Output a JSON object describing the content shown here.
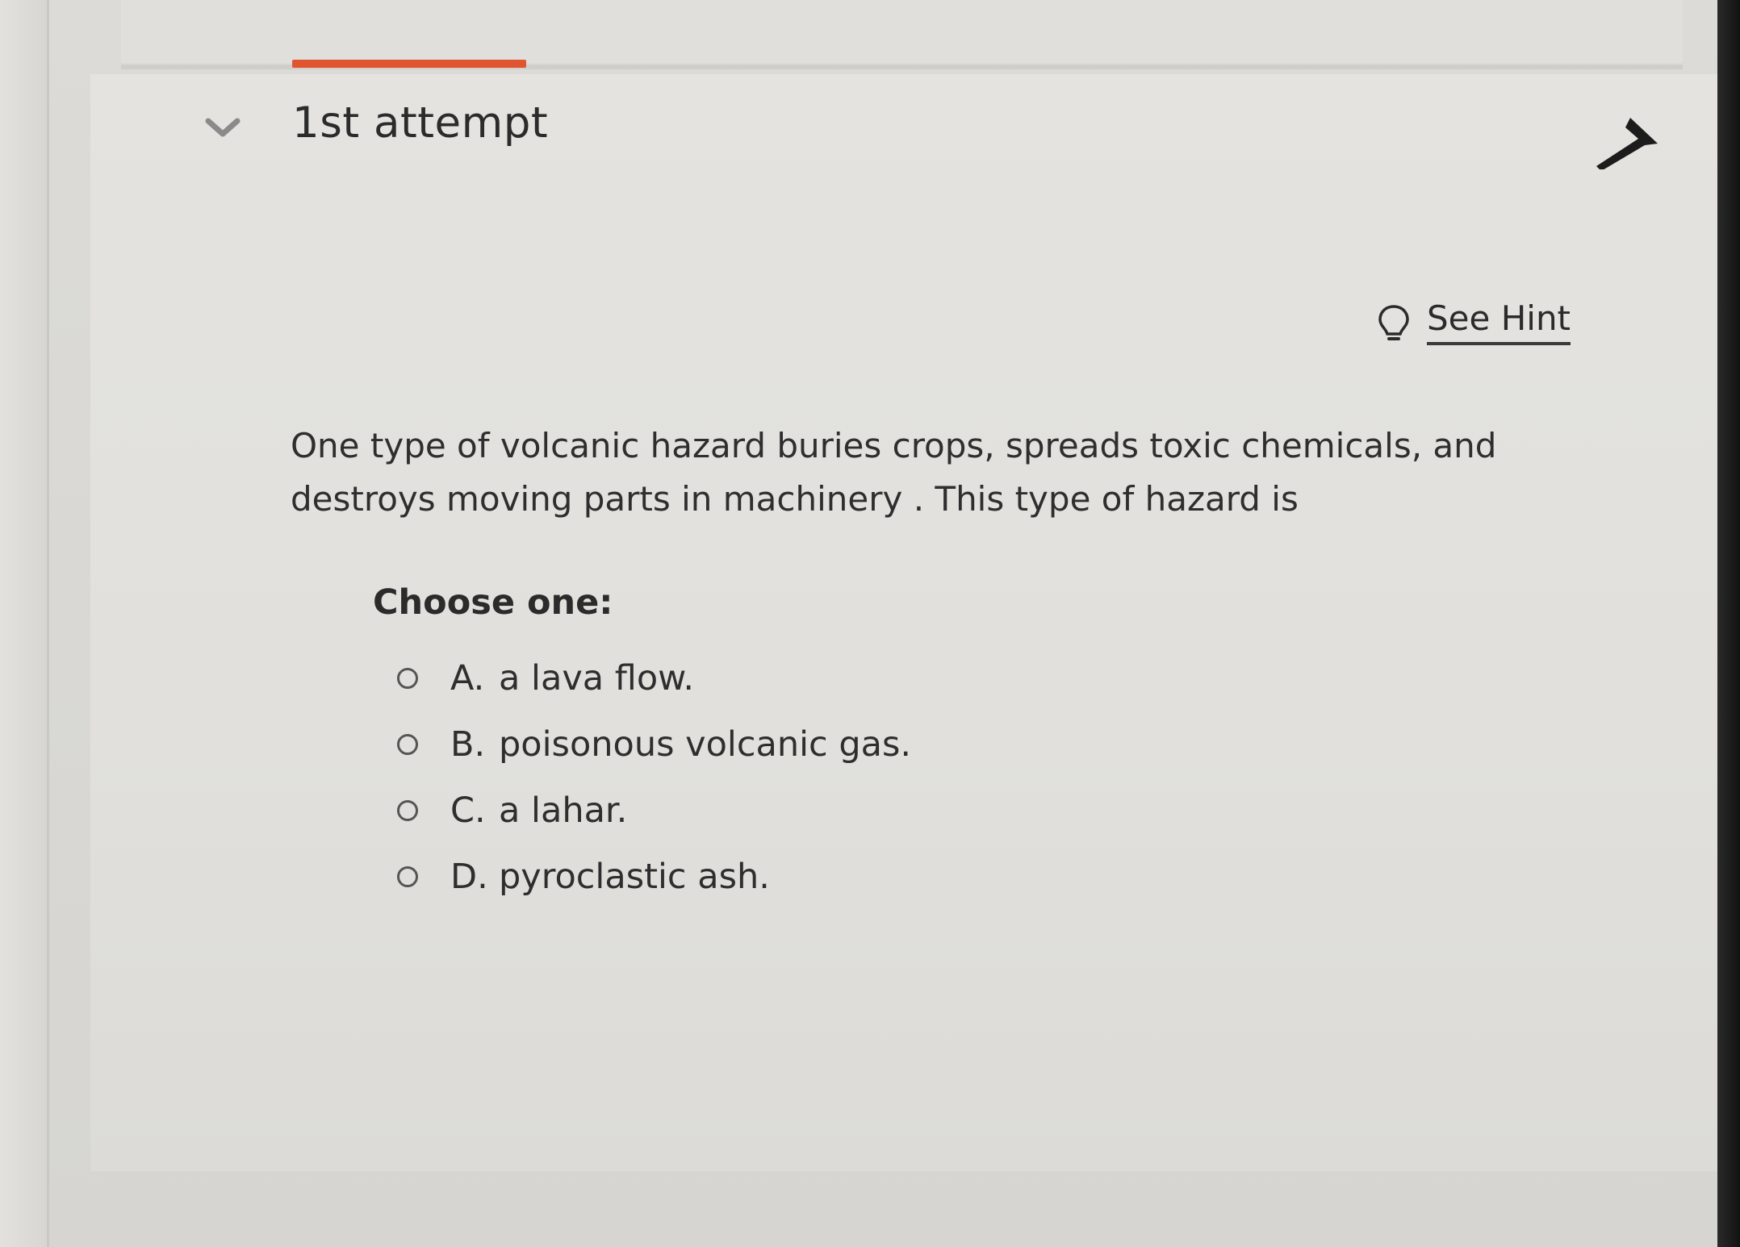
{
  "attempt": {
    "title": "1st attempt"
  },
  "hint": {
    "label": "See Hint"
  },
  "question": {
    "text": "One type of volcanic hazard buries crops, spreads toxic chemicals, and destroys moving parts in machinery . This type of hazard is"
  },
  "choices": {
    "prompt": "Choose one:",
    "options": [
      {
        "letter": "A.",
        "text": "a lava flow."
      },
      {
        "letter": "B.",
        "text": "poisonous volcanic gas."
      },
      {
        "letter": "C.",
        "text": "a lahar."
      },
      {
        "letter": "D.",
        "text": "pyroclastic ash."
      }
    ]
  },
  "colors": {
    "accent": "#e0552f",
    "text": "#2b2b2b",
    "background": "#e2e1dd"
  },
  "icons": {
    "expand": "chevron-down-icon",
    "collapse": "arrow-up-icon",
    "hint": "lightbulb-icon"
  }
}
